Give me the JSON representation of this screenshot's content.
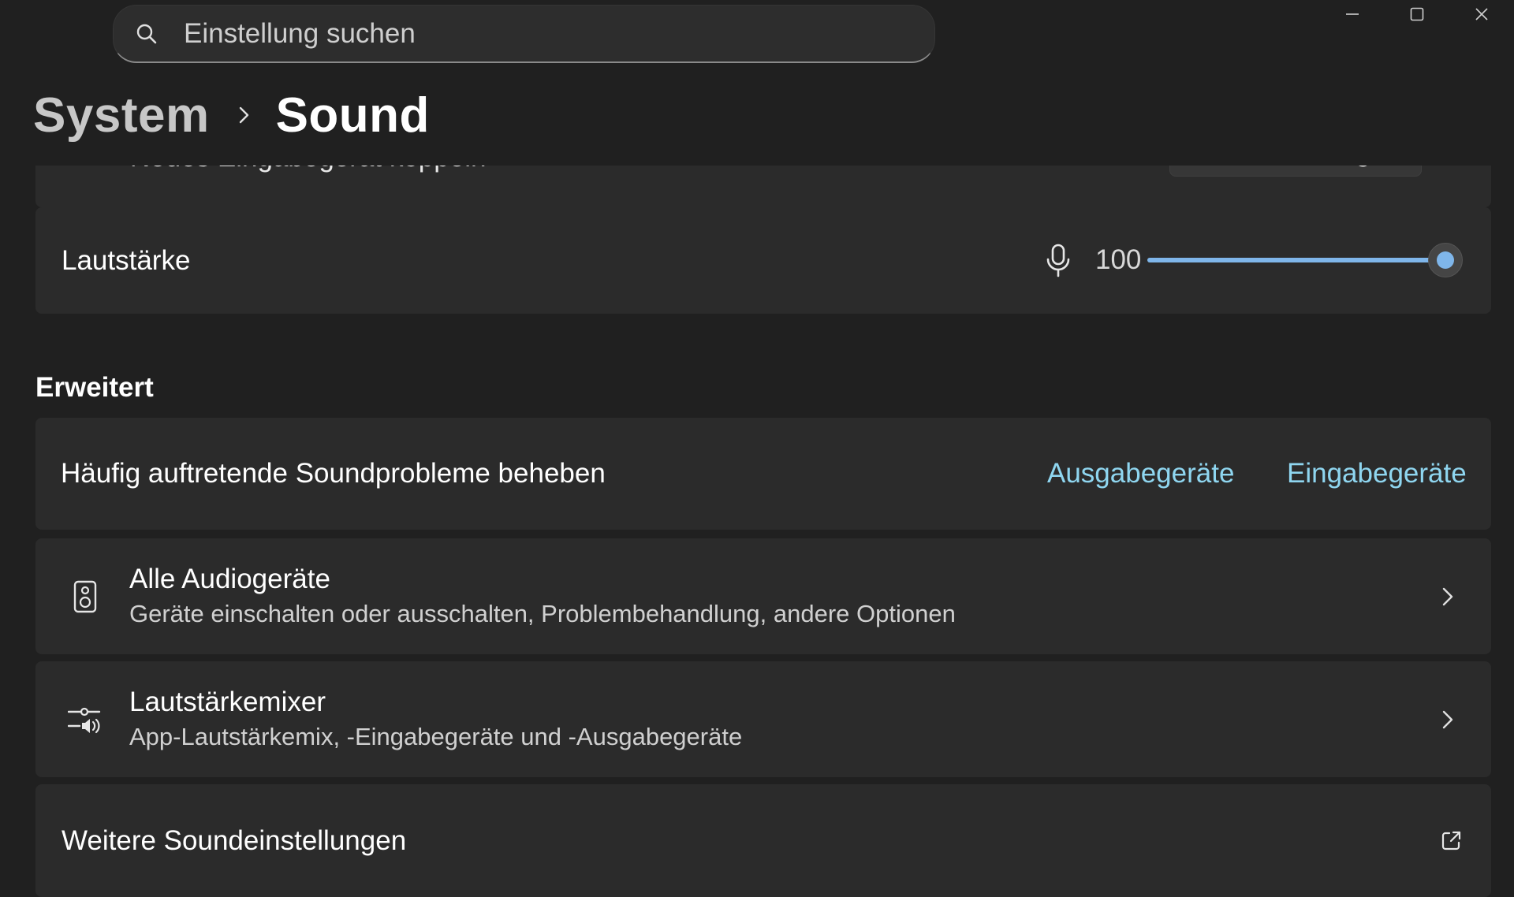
{
  "search": {
    "placeholder": "Einstellung suchen",
    "value": ""
  },
  "window_controls": {
    "icons": [
      "minimize-icon",
      "maximize-icon",
      "close-icon"
    ]
  },
  "breadcrumb": {
    "parent": "System",
    "current": "Sound"
  },
  "partial_row": {
    "label": "Neues Eingabegerät koppeln",
    "button": "Gerät hinzufügen"
  },
  "volume": {
    "label": "Lautstärke",
    "value": "100",
    "level": 1.0,
    "icon": "microphone-icon"
  },
  "advanced": {
    "section_title": "Erweitert",
    "troubleshoot": {
      "label": "Häufig auftretende Soundprobleme beheben",
      "link_output": "Ausgabegeräte",
      "link_input": "Eingabegeräte"
    },
    "all_audio_devices": {
      "title": "Alle Audiogeräte",
      "subtitle": "Geräte einschalten oder ausschalten, Problembehandlung, andere Optionen",
      "icon": "speaker-icon"
    },
    "volume_mixer": {
      "title": "Lautstärkemixer",
      "subtitle": "App-Lautstärkemix, -Eingabegeräte und -Ausgabegeräte",
      "icon": "mixer-icon"
    },
    "more_sound_settings": {
      "label": "Weitere Soundeinstellungen",
      "icon": "external-link-icon"
    }
  },
  "colors": {
    "background": "#202020",
    "card": "#2b2b2b",
    "accent": "#7fb6ea",
    "link": "#8fd6f0"
  }
}
